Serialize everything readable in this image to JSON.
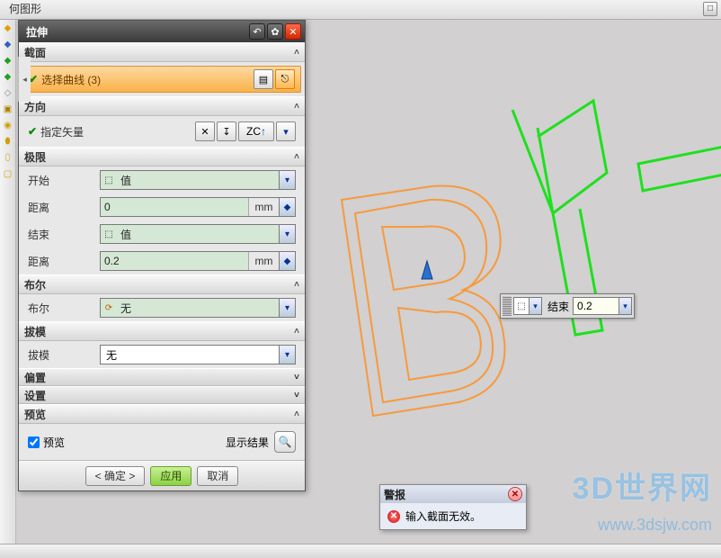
{
  "app": {
    "top_label": "何图形"
  },
  "dialog": {
    "title": "拉伸",
    "sections": {
      "section1": {
        "title": "截面",
        "select_curve": "选择曲线 (3)"
      },
      "direction": {
        "title": "方向",
        "specify_vector": "指定矢量",
        "axis_label": "ZC"
      },
      "limits": {
        "title": "极限",
        "start_label": "开始",
        "start_value": "值",
        "start_dist_label": "距离",
        "start_dist_value": "0",
        "start_dist_unit": "mm",
        "end_label": "结束",
        "end_value": "值",
        "end_dist_label": "距离",
        "end_dist_value": "0.2",
        "end_dist_unit": "mm"
      },
      "boolean": {
        "title": "布尔",
        "label": "布尔",
        "value": "无"
      },
      "draft": {
        "title": "拔模",
        "label": "拔模",
        "value": "无"
      },
      "offset": {
        "title": "偏置"
      },
      "settings": {
        "title": "设置"
      },
      "preview": {
        "title": "预览",
        "checkbox_label": "预览",
        "show_result": "显示结果"
      }
    },
    "buttons": {
      "ok": "< 确定 >",
      "apply": "应用",
      "cancel": "取消"
    }
  },
  "float_popup": {
    "end_label": "结束",
    "end_value": "0.2"
  },
  "alert": {
    "title": "警报",
    "message": "输入截面无效。"
  },
  "watermark": {
    "line1": "3D世界网",
    "line2": "www.3dsjw.com"
  }
}
